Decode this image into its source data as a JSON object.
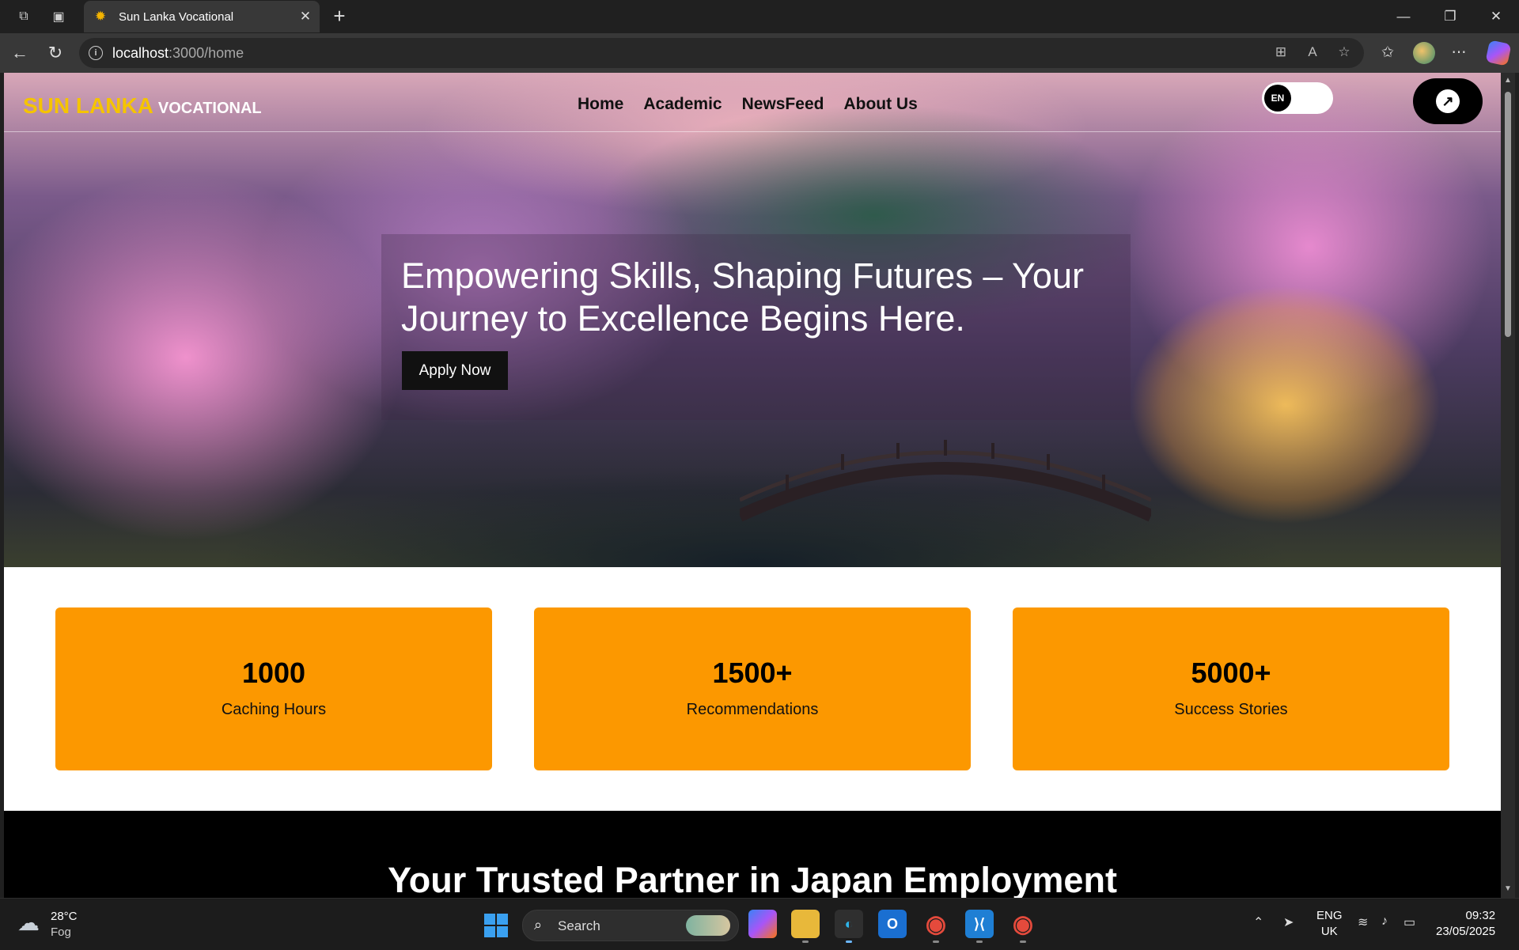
{
  "browser": {
    "tab_title": "Sun Lanka Vocational",
    "url_host": "localhost",
    "url_path": ":3000/home",
    "tab_close": "✕",
    "new_tab": "+"
  },
  "site": {
    "logo_primary": "SUN LANKA",
    "logo_secondary": "VOCATIONAL",
    "nav": [
      "Home",
      "Academic",
      "NewsFeed",
      "About Us"
    ],
    "lang_label": "EN",
    "action_glyph": "↗"
  },
  "hero": {
    "title": "Empowering Skills, Shaping Futures – Your Journey to Excellence Begins Here.",
    "cta_label": "Apply Now"
  },
  "stats": [
    {
      "value": "1000",
      "label": "Caching Hours"
    },
    {
      "value": "1500+",
      "label": "Recommendations"
    },
    {
      "value": "5000+",
      "label": "Success Stories"
    }
  ],
  "section": {
    "title": "Your Trusted Partner in Japan Employment"
  },
  "taskbar": {
    "weather_temp": "28°C",
    "weather_desc": "Fog",
    "search_label": "Search",
    "lang_line1": "ENG",
    "lang_line2": "UK",
    "time": "09:32",
    "date": "23/05/2025"
  },
  "colors": {
    "accent_orange": "#fc9800",
    "logo_yellow": "#f5c400",
    "dark": "#000000"
  },
  "icons": {
    "workspaces": "workspaces-icon",
    "tab_actions": "tab-actions-icon",
    "favicon": "sun-favicon-icon",
    "back": "back-arrow-icon",
    "refresh": "refresh-icon",
    "info": "site-info-icon",
    "favorites": "favorites-icon",
    "more": "more-icon"
  }
}
